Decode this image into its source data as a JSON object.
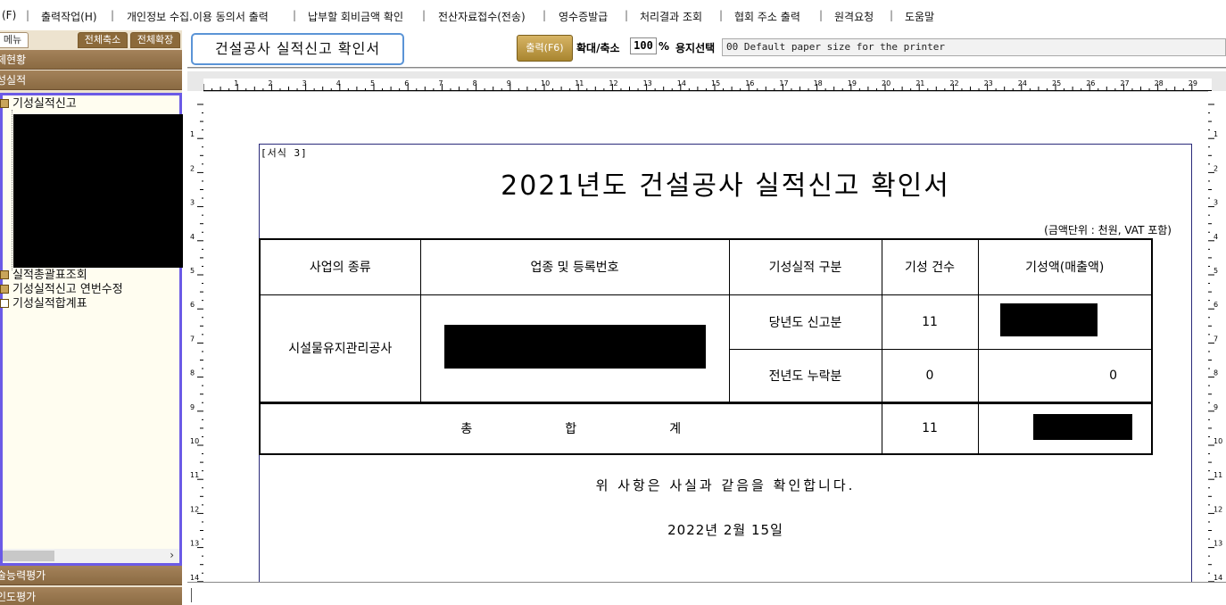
{
  "menubar": {
    "items": [
      "(F)",
      "출력작업(H)",
      "개인정보 수집.이용 동의서 출력",
      "납부할 회비금액 확인",
      "전산자료접수(전송)",
      "영수증발급",
      "처리결과 조회",
      "협회 주소 출력",
      "원격요청",
      "도움말"
    ]
  },
  "sidebar": {
    "tab_menu": "메뉴",
    "tab_collapse": "전체축소",
    "tab_expand": "전체확장",
    "section_top": "체현황",
    "section_main": "성실적",
    "tree": {
      "items": [
        "기성실적신고",
        "실적총괄표조회",
        "기성실적신고 연번수정",
        "기성실적합계표"
      ]
    },
    "section_bottom_1": "술능력평가",
    "section_bottom_2": "인도평가"
  },
  "toolbar": {
    "title": "건설공사 실적신고 확인서",
    "print_label": "출력(F6)",
    "zoom_label": "확대/축소",
    "zoom_value": "100",
    "zoom_unit": "%",
    "paper_label": "용지선택",
    "paper_value": "00   Default paper size for the printer"
  },
  "ruler": {
    "top_numbers": [
      "1",
      "2",
      "3",
      "4",
      "5",
      "6",
      "7",
      "8",
      "9",
      "10",
      "11",
      "12",
      "13",
      "14",
      "15",
      "16",
      "17",
      "18",
      "19",
      "20",
      "21",
      "22",
      "23",
      "24",
      "25",
      "26",
      "27",
      "28",
      "29"
    ],
    "side_numbers": [
      "1",
      "2",
      "3",
      "4",
      "5",
      "6",
      "7",
      "8",
      "9",
      "10",
      "11",
      "12",
      "13",
      "14"
    ]
  },
  "document": {
    "form_no": "[서식 3]",
    "title": "2021년도 건설공사 실적신고 확인서",
    "unit_note": "(금액단위 : 천원, VAT 포함)",
    "headers": {
      "business_type": "사업의 종류",
      "registration": "업종 및 등록번호",
      "category": "기성실적 구분",
      "count": "기성 건수",
      "amount": "기성액(매출액)"
    },
    "row": {
      "business_type": "시설물유지관리공사",
      "current_label": "당년도 신고분",
      "current_count": "11",
      "previous_label": "전년도 누락분",
      "previous_count": "0",
      "previous_amount": "0"
    },
    "total": {
      "label_1": "총",
      "label_2": "합",
      "label_3": "계",
      "count": "11"
    },
    "confirm_text": "위 사항은 사실과 같음을 확인합니다.",
    "date": "2022년 2월 15일"
  },
  "colors": {
    "sidebar_bg": "#ede3cf",
    "sidebar_header": "#8a6a42",
    "tree_border": "#6b5ae6",
    "title_border": "#5b94d6",
    "print_button": "#c19b46"
  }
}
